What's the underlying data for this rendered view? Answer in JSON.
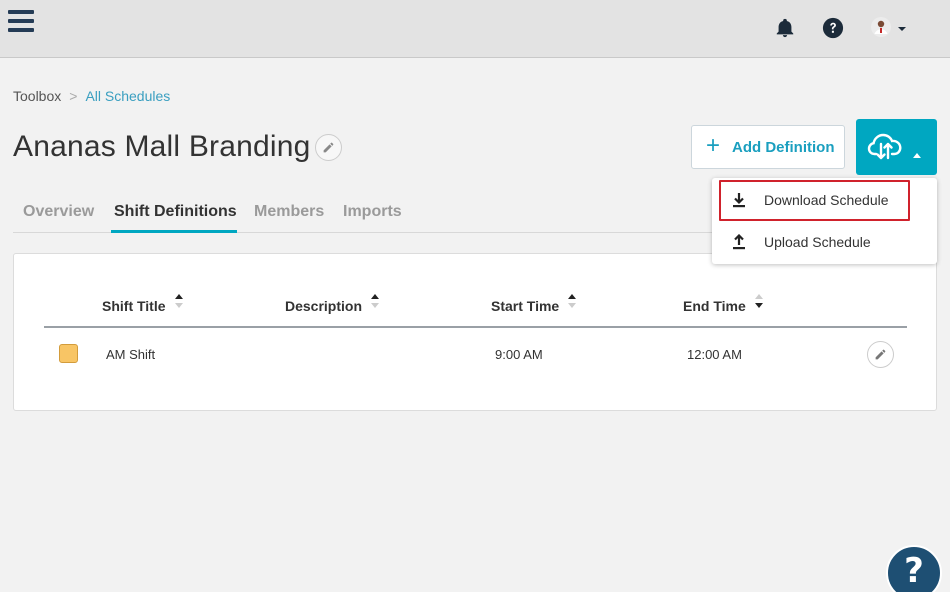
{
  "header": {
    "menu_icon": "hamburger-icon",
    "notifications_icon": "bell-icon",
    "help_icon": "question-circle-icon",
    "user_icon": "avatar-icon"
  },
  "breadcrumb": {
    "root": "Toolbox",
    "separator": ">",
    "current": "All Schedules"
  },
  "page": {
    "title": "Ananas Mall Branding"
  },
  "actions": {
    "add_definition": "Add Definition",
    "cloud_menu_icon": "cloud-upload-download-icon"
  },
  "dropdown": {
    "items": [
      {
        "label": "Download Schedule",
        "icon": "download-icon",
        "highlighted": true
      },
      {
        "label": "Upload Schedule",
        "icon": "upload-icon",
        "highlighted": false
      }
    ]
  },
  "tabs": [
    {
      "label": "Overview",
      "active": false
    },
    {
      "label": "Shift Definitions",
      "active": true
    },
    {
      "label": "Members",
      "active": false
    },
    {
      "label": "Imports",
      "active": false
    }
  ],
  "table": {
    "columns": [
      {
        "label": "Shift Title",
        "sort": "asc"
      },
      {
        "label": "Description",
        "sort": "asc"
      },
      {
        "label": "Start Time",
        "sort": "asc"
      },
      {
        "label": "End Time",
        "sort": "desc"
      }
    ],
    "rows": [
      {
        "color": "#f8c565",
        "title": "AM Shift",
        "description": "",
        "start": "9:00 AM",
        "end": "12:00 AM"
      }
    ]
  },
  "colors": {
    "accent": "#00a7c1",
    "link": "#3a9fc0",
    "highlight_border": "#d0222c",
    "help_fab": "#1e4f73"
  },
  "help_fab": {
    "label": "?"
  }
}
